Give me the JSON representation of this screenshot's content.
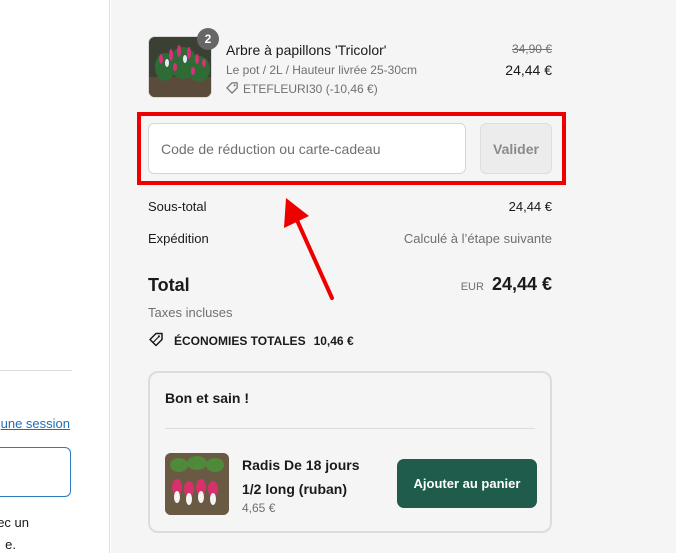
{
  "left_panel": {
    "login_link": "une session",
    "text_line1": "ec un",
    "text_line2": "e."
  },
  "cart": {
    "item": {
      "name": "Arbre à papillons 'Tricolor'",
      "variant": "Le pot / 2L / Hauteur livrée 25-30cm",
      "discount": "ETEFLEURI30 (-10,46 €)",
      "quantity": "2",
      "original_price": "34,90 €",
      "price": "24,44 €"
    }
  },
  "discount_form": {
    "placeholder": "Code de réduction ou carte-cadeau",
    "value": "",
    "button": "Valider"
  },
  "summary": {
    "subtotal_label": "Sous-total",
    "subtotal_value": "24,44 €",
    "shipping_label": "Expédition",
    "shipping_value": "Calculé à l’étape suivante",
    "total_label": "Total",
    "currency": "EUR",
    "total_value": "24,44 €",
    "taxes_note": "Taxes incluses",
    "savings_label": "ÉCONOMIES TOTALES",
    "savings_value": "10,46 €"
  },
  "upsell": {
    "title": "Bon et sain !",
    "product_name": "Radis De 18 jours 1/2 long (ruban)",
    "price": "4,65 €",
    "button": "Ajouter au panier"
  },
  "colors": {
    "annotation_red": "#ef0000",
    "add_button_bg": "#1f5c4b",
    "link_blue": "#1f6fb5",
    "summary_bg": "#f5f5f5"
  },
  "icons": [
    "tag-icon",
    "savings-tags-icon",
    "annotation-arrow"
  ]
}
